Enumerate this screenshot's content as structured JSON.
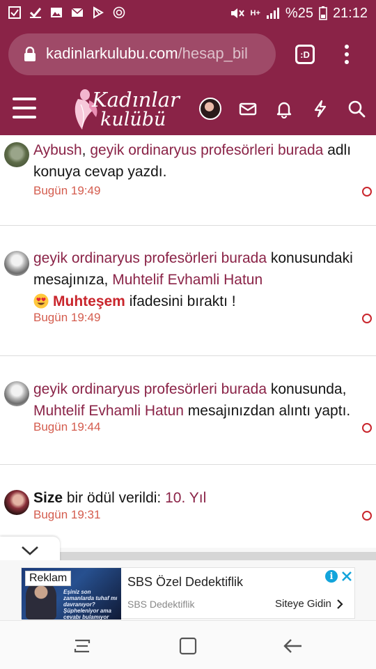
{
  "status_bar": {
    "battery": "%25",
    "time": "21:12",
    "network": "H+"
  },
  "browser": {
    "url_domain": "kadinlarkulubu.com",
    "url_path": "/hesap_bil",
    "tab_label": ":D"
  },
  "site": {
    "logo_line1": "Kadınlar",
    "logo_line2": "kulübü",
    "brand_color": "#8a2347"
  },
  "notifications": [
    {
      "user": "Aybush",
      "sep": ", ",
      "thread": "geyik ordinaryus profesörleri burada",
      "text": " adlı konuya cevap yazdı.",
      "time": "Bugün 19:49"
    },
    {
      "thread": "geyik ordinaryus profesörleri burada",
      "text_mid": " konusundaki mesajınıza, ",
      "user": "Muhtelif Evhamli Hatun",
      "reaction": "Muhteşem",
      "text_end": " ifadesini bıraktı !",
      "time": "Bugün 19:49"
    },
    {
      "thread": "geyik ordinaryus profesörleri burada",
      "text_mid": " konusunda, ",
      "user": "Muhtelif Evhamli Hatun",
      "text_end": " mesajınızdan alıntı yaptı.",
      "time": "Bugün 19:44"
    },
    {
      "strong": "Size",
      "text_mid": " bir ödül verildi: ",
      "award": "10. Yıl",
      "time": "Bugün 19:31"
    }
  ],
  "ad": {
    "badge": "Reklam",
    "title": "SBS Özel Dedektiflik",
    "subtitle": "SBS Dedektiflik",
    "cta": "Siteye Gidin",
    "info": "i",
    "image_text": "Eşiniz son zamanlarda tuhaf mı davranıyor? Şüpheleniyor ama cevabı bulamıyor musunuz?"
  }
}
